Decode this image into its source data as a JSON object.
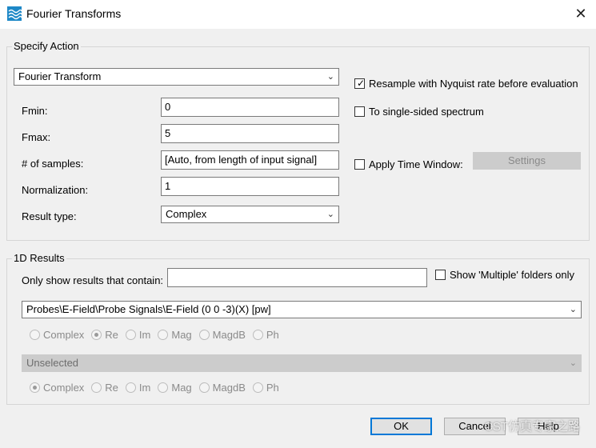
{
  "window": {
    "title": "Fourier Transforms",
    "close_symbol": "✕"
  },
  "specify_action": {
    "group_title": "Specify Action",
    "action_select": "Fourier Transform",
    "resample_label": "Resample with Nyquist rate before evaluation",
    "resample_checked": true,
    "single_sided_label": "To single-sided spectrum",
    "single_sided_checked": false,
    "apply_window_label": "Apply Time Window:",
    "apply_window_checked": false,
    "settings_label": "Settings",
    "fields": {
      "fmin": {
        "label": "Fmin:",
        "value": "0"
      },
      "fmax": {
        "label": "Fmax:",
        "value": "5"
      },
      "samples": {
        "label": "# of samples:",
        "value": "[Auto, from length of input signal]"
      },
      "normalization": {
        "label": "Normalization:",
        "value": "1"
      },
      "result_type": {
        "label": "Result type:",
        "value": "Complex"
      }
    }
  },
  "results": {
    "group_title": "1D Results",
    "filter_label": "Only show results that contain:",
    "filter_value": "",
    "multiple_label": "Show 'Multiple' folders only",
    "multiple_checked": false,
    "first_select": "Probes\\E-Field\\Probe Signals\\E-Field (0 0 -3)(X) [pw]",
    "first_radios": {
      "selected": "Re",
      "options": [
        "Complex",
        "Re",
        "Im",
        "Mag",
        "MagdB",
        "Ph"
      ]
    },
    "second_select": "Unselected",
    "second_radios": {
      "selected": "Complex",
      "options": [
        "Complex",
        "Re",
        "Im",
        "Mag",
        "MagdB",
        "Ph"
      ]
    }
  },
  "buttons": {
    "ok": "OK",
    "cancel": "Cancel",
    "help": "Help"
  },
  "watermark": "CST仿真专家之路"
}
